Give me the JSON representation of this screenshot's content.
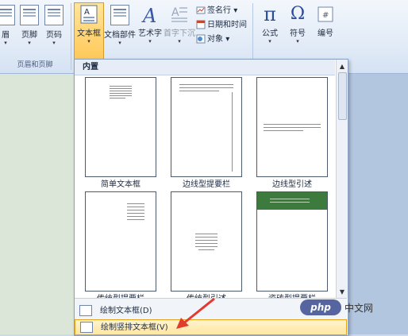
{
  "ribbon": {
    "header_footer_group": {
      "label": "页眉和页脚",
      "buttons": [
        {
          "label": "眉",
          "icon": "page-header-icon"
        },
        {
          "label": "页脚",
          "icon": "page-footer-icon"
        },
        {
          "label": "页码",
          "icon": "page-number-icon"
        }
      ]
    },
    "text_group": {
      "textbox_label": "文本框",
      "parts_label": "文档部件",
      "wordart_label": "艺术字",
      "dropcap_label": "首字下沉",
      "signature_label": "签名行",
      "signature_arrow": "▾",
      "datetime_label": "日期和时间",
      "object_label": "对象",
      "object_arrow": "▾"
    },
    "symbols_group": {
      "equation_label": "公式",
      "equation_glyph": "π",
      "symbol_label": "符号",
      "symbol_glyph": "Ω",
      "number_label": "编号"
    }
  },
  "gallery": {
    "header": "内置",
    "items": [
      {
        "label": "简单文本框"
      },
      {
        "label": "边线型提要栏"
      },
      {
        "label": "边线型引述"
      },
      {
        "label": "传统型提要栏"
      },
      {
        "label": "传统型引述"
      },
      {
        "label": "瓷砖型提要栏"
      }
    ],
    "menu": [
      {
        "label": "绘制文本框(D)"
      },
      {
        "label": "绘制竖排文本框(V)"
      }
    ],
    "scroll_up": "▲",
    "scroll_down": "▼"
  },
  "watermark": {
    "logo": "php",
    "text": "中文网"
  },
  "colors": {
    "ribbon_bg": "#e2ebf7",
    "highlight": "#ffc95a",
    "annotation_arrow": "#e23b2e",
    "tile_green": "#3d7a3d"
  }
}
